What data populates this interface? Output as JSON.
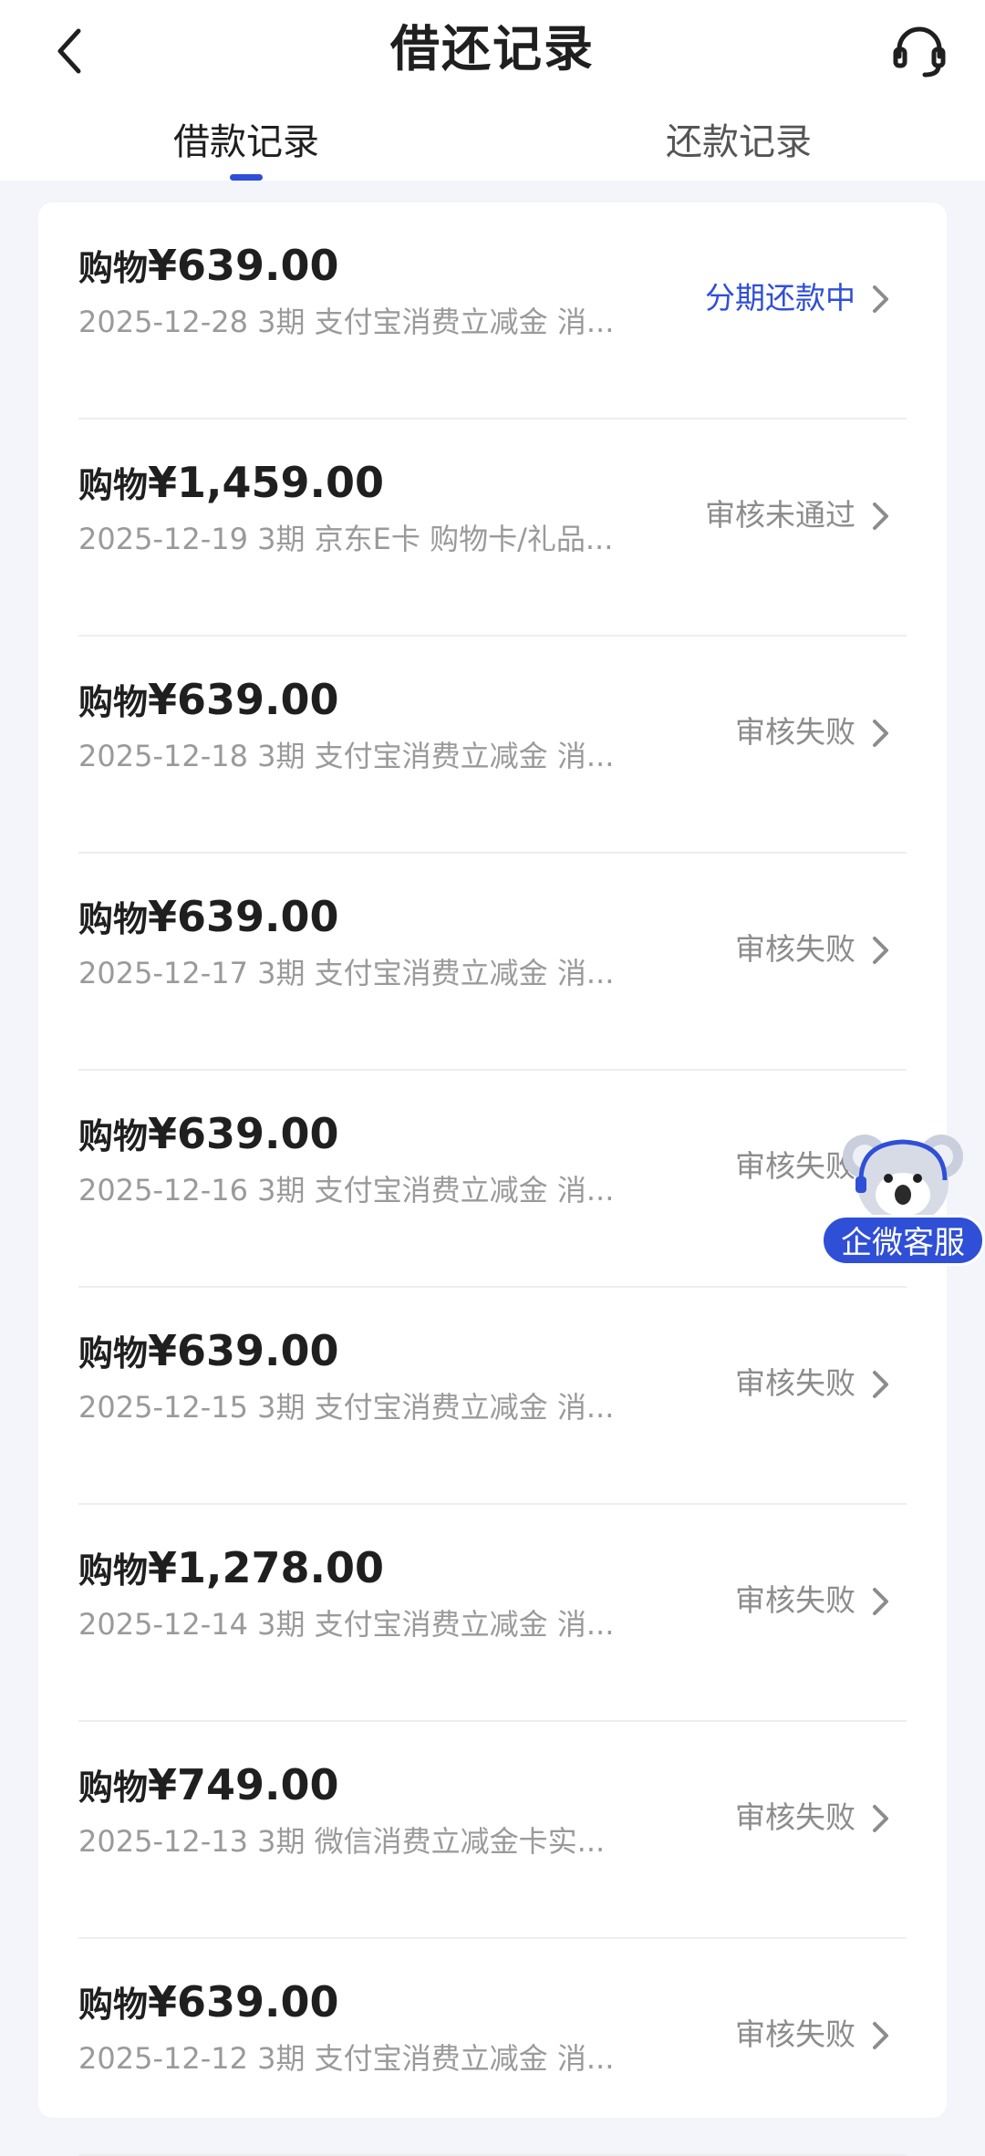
{
  "header": {
    "title": "借还记录",
    "back_icon": "chevron-left-icon",
    "service_icon": "headset-icon"
  },
  "tabs": [
    {
      "label": "借款记录",
      "active": true
    },
    {
      "label": "还款记录",
      "active": false
    }
  ],
  "colors": {
    "accent": "#2f4fd6",
    "status_gray": "#8c8c8c",
    "detail_gray": "#9a9a9a"
  },
  "records": [
    {
      "prefix": "购物",
      "amount": "¥639.00",
      "detail": "2025-12-28 3期  支付宝消费立减金 消...",
      "status": "分期还款中",
      "active": true
    },
    {
      "prefix": "购物",
      "amount": "¥1,459.00",
      "detail": "2025-12-19 3期  京东E卡 购物卡/礼品...",
      "status": "审核未通过",
      "active": false
    },
    {
      "prefix": "购物",
      "amount": "¥639.00",
      "detail": "2025-12-18 3期  支付宝消费立减金 消...",
      "status": "审核失败",
      "active": false
    },
    {
      "prefix": "购物",
      "amount": "¥639.00",
      "detail": "2025-12-17 3期  支付宝消费立减金 消...",
      "status": "审核失败",
      "active": false
    },
    {
      "prefix": "购物",
      "amount": "¥639.00",
      "detail": "2025-12-16 3期  支付宝消费立减金 消...",
      "status": "审核失败",
      "active": false
    },
    {
      "prefix": "购物",
      "amount": "¥639.00",
      "detail": "2025-12-15 3期  支付宝消费立减金 消...",
      "status": "审核失败",
      "active": false
    },
    {
      "prefix": "购物",
      "amount": "¥1,278.00",
      "detail": "2025-12-14 3期  支付宝消费立减金 消...",
      "status": "审核失败",
      "active": false
    },
    {
      "prefix": "购物",
      "amount": "¥749.00",
      "detail": "2025-12-13 3期  微信消费立减金卡实...",
      "status": "审核失败",
      "active": false
    },
    {
      "prefix": "购物",
      "amount": "¥639.00",
      "detail": "2025-12-12 3期  支付宝消费立减金 消...",
      "status": "审核失败",
      "active": false
    }
  ],
  "floating_service": {
    "label": "企微客服",
    "icon": "koala-mascot-icon"
  }
}
